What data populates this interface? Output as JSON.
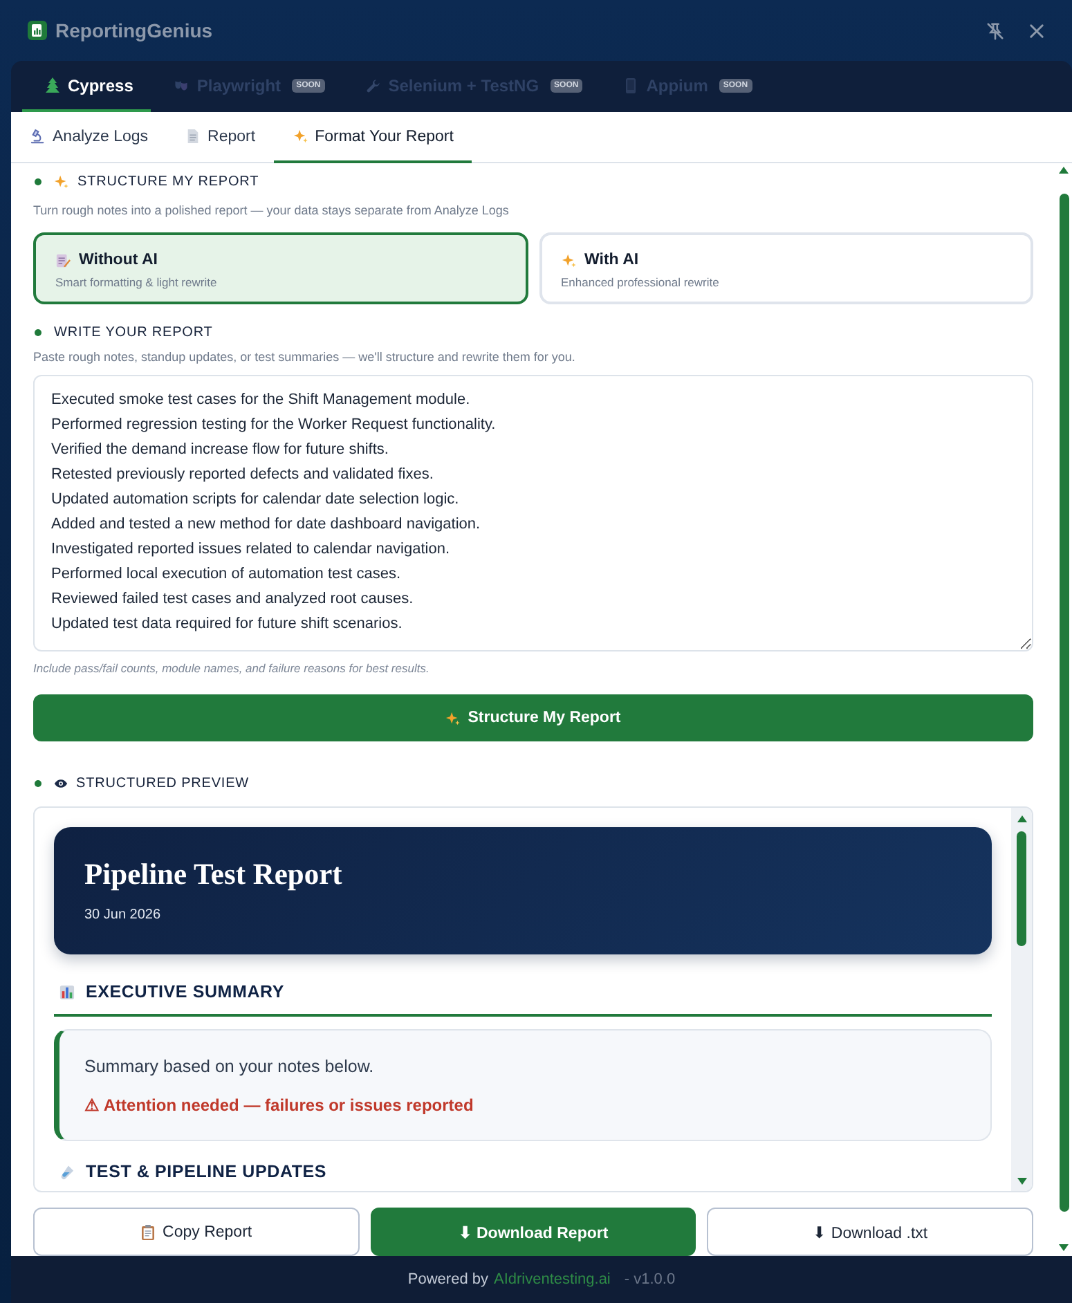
{
  "window": {
    "title": "ReportingGenius"
  },
  "framework_tabs": [
    {
      "label": "Cypress",
      "selected": true,
      "disabled": false
    },
    {
      "label": "Playwright",
      "badge": "SOON",
      "selected": false,
      "disabled": true
    },
    {
      "label": "Selenium + TestNG",
      "badge": "SOON",
      "selected": false,
      "disabled": true
    },
    {
      "label": "Appium",
      "badge": "SOON",
      "selected": false,
      "disabled": true
    }
  ],
  "tabs": [
    {
      "label": "Analyze Logs",
      "selected": false
    },
    {
      "label": "Report",
      "selected": false
    },
    {
      "label": "Format Your Report",
      "selected": true
    }
  ],
  "structure": {
    "title": "STRUCTURE MY REPORT",
    "subtitle": "Turn rough notes into a polished report — your data stays separate from Analyze Logs",
    "options": [
      {
        "title": "Without AI",
        "description": "Smart formatting & light rewrite",
        "selected": true
      },
      {
        "title": "With AI",
        "description": "Enhanced professional rewrite",
        "selected": false
      }
    ]
  },
  "write": {
    "title": "WRITE YOUR REPORT",
    "subtitle": "Paste rough notes, standup updates, or test summaries — we'll structure and rewrite them for you.",
    "notes": {
      "value": "Executed smoke test cases for the Shift Management module.\nPerformed regression testing for the Worker Request functionality.\nVerified the demand increase flow for future shifts.\nRetested previously reported defects and validated fixes.\nUpdated automation scripts for calendar date selection logic.\nAdded and tested a new method for date dashboard navigation.\nInvestigated reported issues related to calendar navigation.\nPerformed local execution of automation test cases.\nReviewed failed test cases and analyzed root causes.\nUpdated test data required for future shift scenarios."
    },
    "hint": "Include pass/fail counts, module names, and failure reasons for best results.",
    "submit_button": "Structure My Report"
  },
  "preview": {
    "title": "STRUCTURED PREVIEW",
    "report": {
      "title": "Pipeline Test Report",
      "date": "30 Jun 2026",
      "sections": [
        {
          "heading": "EXECUTIVE SUMMARY",
          "summary": "Summary based on your notes below.",
          "alert": "⚠ Attention needed — failures or issues reported"
        },
        {
          "heading": "TEST & PIPELINE UPDATES"
        }
      ]
    }
  },
  "actions": [
    {
      "label": "Copy Report",
      "kind": "secondary"
    },
    {
      "label": "⬇ Download Report",
      "kind": "primary"
    },
    {
      "label": "⬇ Download .txt",
      "kind": "secondary"
    }
  ],
  "footer": {
    "prefix": "Powered by",
    "link": "AIdriventesting.ai",
    "version": "- v1.0.0"
  }
}
